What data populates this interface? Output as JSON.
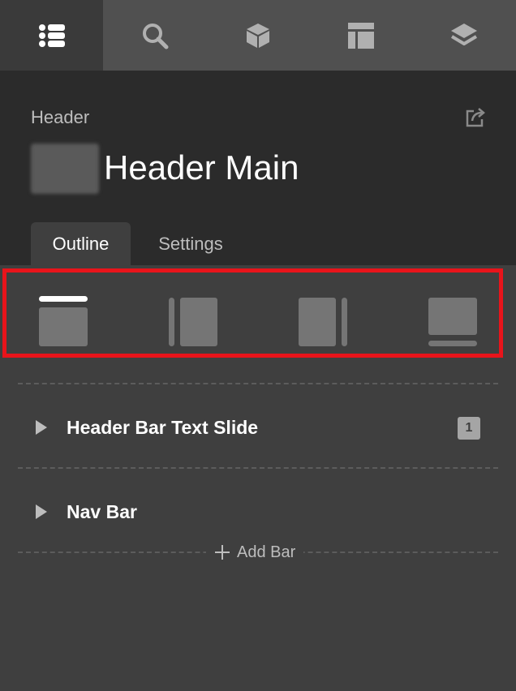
{
  "toolbar": {
    "icons": [
      "list-icon",
      "search-icon",
      "cube-icon",
      "layout-icon",
      "layers-icon"
    ],
    "active_index": 0
  },
  "panel": {
    "section_label": "Header",
    "title": "Header Main",
    "tabs": [
      {
        "label": "Outline",
        "active": true
      },
      {
        "label": "Settings",
        "active": false
      }
    ]
  },
  "layouts": [
    "header-top-layout-icon",
    "sidebar-left-layout-icon",
    "sidebar-right-layout-icon",
    "footer-bottom-layout-icon"
  ],
  "bars": [
    {
      "label": "Header Bar Text Slide",
      "badge": "1"
    },
    {
      "label": "Nav Bar",
      "badge": ""
    }
  ],
  "add_bar": {
    "label": "Add Bar"
  },
  "colors": {
    "highlight": "#e8141b",
    "toolbar_bg": "#505050",
    "panel_bg": "#2b2b2b",
    "body_bg": "#3f3f3f"
  }
}
